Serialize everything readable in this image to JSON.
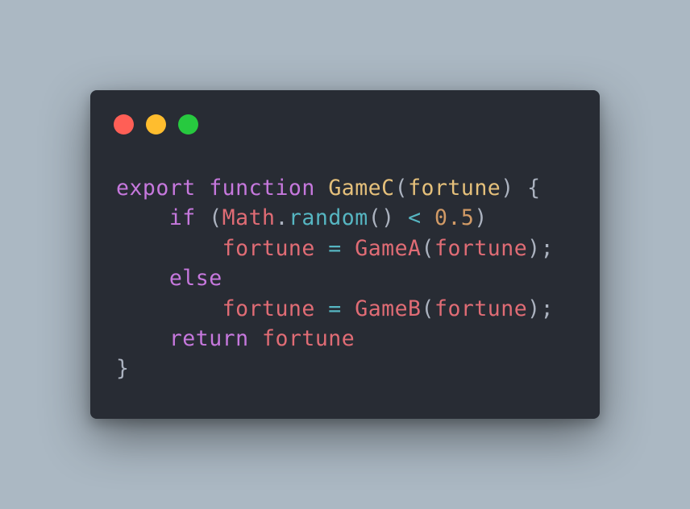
{
  "window": {
    "background": "#282c34",
    "buttons": [
      {
        "name": "close",
        "color": "#ff5f56"
      },
      {
        "name": "minimize",
        "color": "#ffbd2e"
      },
      {
        "name": "maximize",
        "color": "#27c93f"
      }
    ]
  },
  "syntax_colors": {
    "keyword": "#c678dd",
    "function": "#e5c07b",
    "variable": "#e06c75",
    "method": "#56b6c2",
    "operator": "#56b6c2",
    "number": "#d19a66",
    "punctuation": "#abb2bf"
  },
  "code": {
    "lines": [
      {
        "indent": "",
        "tokens": [
          {
            "t": "export",
            "k": "keyword"
          },
          {
            "t": " ",
            "k": "punctuation"
          },
          {
            "t": "function",
            "k": "keyword"
          },
          {
            "t": " ",
            "k": "punctuation"
          },
          {
            "t": "GameC",
            "k": "function"
          },
          {
            "t": "(",
            "k": "punctuation"
          },
          {
            "t": "fortune",
            "k": "function"
          },
          {
            "t": ") {",
            "k": "punctuation"
          }
        ]
      },
      {
        "indent": "    ",
        "tokens": [
          {
            "t": "if",
            "k": "keyword"
          },
          {
            "t": " (",
            "k": "punctuation"
          },
          {
            "t": "Math",
            "k": "variable"
          },
          {
            "t": ".",
            "k": "punctuation"
          },
          {
            "t": "random",
            "k": "method"
          },
          {
            "t": "() ",
            "k": "punctuation"
          },
          {
            "t": "<",
            "k": "operator"
          },
          {
            "t": " ",
            "k": "punctuation"
          },
          {
            "t": "0.5",
            "k": "number"
          },
          {
            "t": ")",
            "k": "punctuation"
          }
        ]
      },
      {
        "indent": "        ",
        "tokens": [
          {
            "t": "fortune",
            "k": "variable"
          },
          {
            "t": " ",
            "k": "punctuation"
          },
          {
            "t": "=",
            "k": "operator"
          },
          {
            "t": " ",
            "k": "punctuation"
          },
          {
            "t": "GameA",
            "k": "variable"
          },
          {
            "t": "(",
            "k": "punctuation"
          },
          {
            "t": "fortune",
            "k": "variable"
          },
          {
            "t": ");",
            "k": "punctuation"
          }
        ]
      },
      {
        "indent": "    ",
        "tokens": [
          {
            "t": "else",
            "k": "keyword"
          }
        ]
      },
      {
        "indent": "        ",
        "tokens": [
          {
            "t": "fortune",
            "k": "variable"
          },
          {
            "t": " ",
            "k": "punctuation"
          },
          {
            "t": "=",
            "k": "operator"
          },
          {
            "t": " ",
            "k": "punctuation"
          },
          {
            "t": "GameB",
            "k": "variable"
          },
          {
            "t": "(",
            "k": "punctuation"
          },
          {
            "t": "fortune",
            "k": "variable"
          },
          {
            "t": ");",
            "k": "punctuation"
          }
        ]
      },
      {
        "indent": "    ",
        "tokens": [
          {
            "t": "return",
            "k": "keyword"
          },
          {
            "t": " ",
            "k": "punctuation"
          },
          {
            "t": "fortune",
            "k": "variable"
          }
        ]
      },
      {
        "indent": "",
        "tokens": [
          {
            "t": "}",
            "k": "punctuation"
          }
        ]
      }
    ]
  }
}
